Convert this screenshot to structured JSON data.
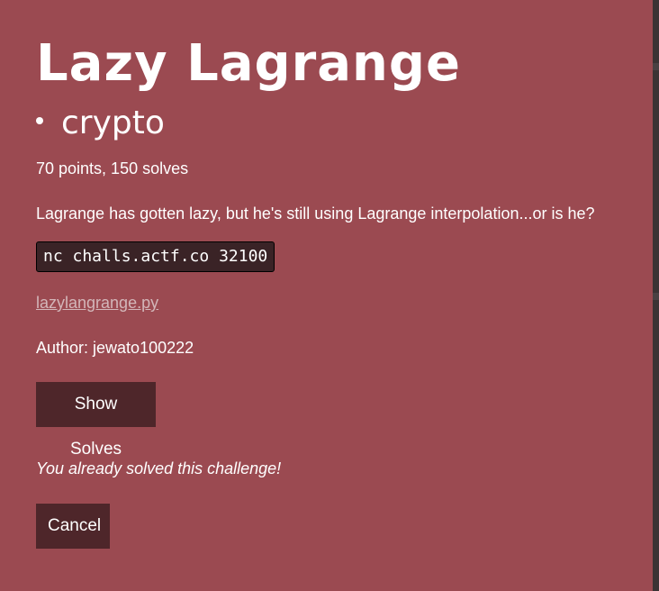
{
  "challenge": {
    "title": "Lazy Lagrange",
    "category": "crypto",
    "points_line": "70 points, 150 solves",
    "description": "Lagrange has gotten lazy, but he's still using Lagrange interpolation...or is he?",
    "connection": "nc challs.actf.co 32100",
    "file_link": "lazylangrange.py",
    "author": "Author: jewato100222"
  },
  "actions": {
    "show_solves_label": "Show Solves",
    "solved_message": "You already solved this challenge!",
    "cancel_label": "Cancel"
  },
  "colors": {
    "modal_background": "#9b4a51",
    "button_background": "#4e262a",
    "code_background": "#3a2326",
    "link_color": "#d3b6b9",
    "text": "#ffffff"
  }
}
